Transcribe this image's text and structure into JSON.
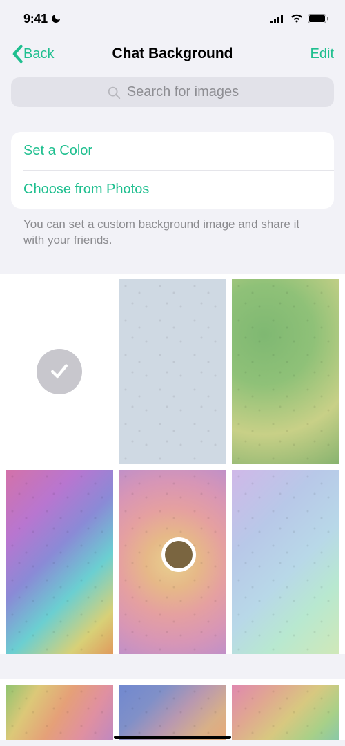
{
  "status_bar": {
    "time": "9:41"
  },
  "nav": {
    "back_label": "Back",
    "title": "Chat Background",
    "edit_label": "Edit"
  },
  "search": {
    "placeholder": "Search for images"
  },
  "options": {
    "set_color": "Set a Color",
    "choose_photos": "Choose from Photos"
  },
  "helper": "You can set a custom background image and share it with your friends.",
  "backgrounds": [
    {
      "name": "white",
      "selected": true
    },
    {
      "name": "light-blue",
      "selected": false
    },
    {
      "name": "green",
      "selected": false
    },
    {
      "name": "rainbow-1",
      "selected": false
    },
    {
      "name": "orange-warm",
      "selected": false
    },
    {
      "name": "pastel",
      "selected": false
    },
    {
      "name": "rainbow-2",
      "selected": false
    },
    {
      "name": "blue-orange",
      "selected": false
    },
    {
      "name": "pink-green",
      "selected": false
    }
  ]
}
